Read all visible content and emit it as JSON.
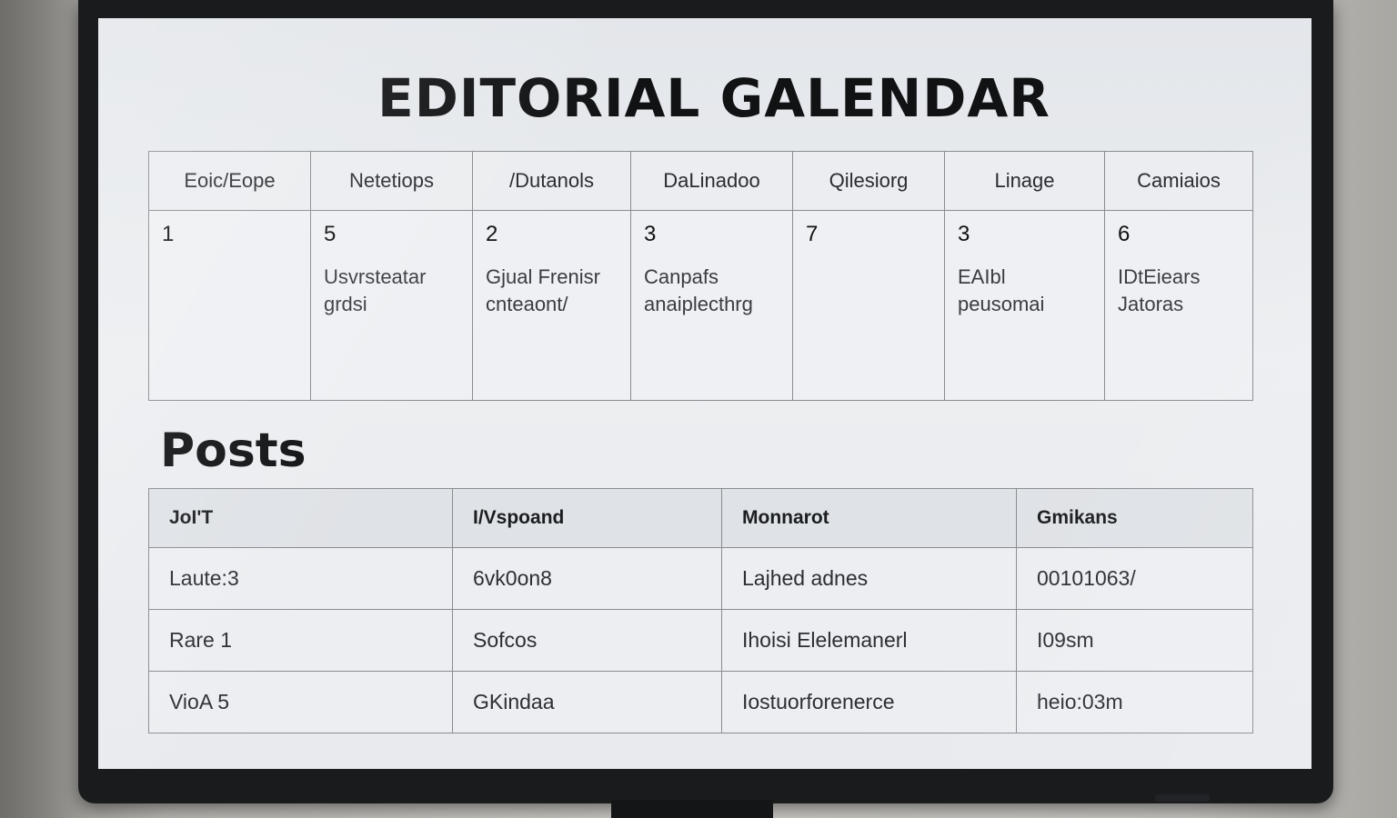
{
  "page_title": "EDITORIAL GALENDAR",
  "calendar": {
    "headers": [
      "Eoic/Eope",
      "Netetiops",
      "/Dutanols",
      "DaLinadoo",
      "Qilesiorg",
      "Linage",
      "Camiaios"
    ],
    "cells": [
      {
        "num": "1",
        "line1": "",
        "line2": ""
      },
      {
        "num": "5",
        "line1": "Usvrsteatar",
        "line2": "grdsi"
      },
      {
        "num": "2",
        "line1": "Gjual Frenisr",
        "line2": "cnteaont/"
      },
      {
        "num": "3",
        "line1": "Canpafs",
        "line2": "anaiplecthrg"
      },
      {
        "num": "7",
        "line1": "",
        "line2": ""
      },
      {
        "num": "3",
        "line1": "EAIbl",
        "line2": "peusomai"
      },
      {
        "num": "6",
        "line1": "IDtEiears",
        "line2": "Jatoras"
      }
    ]
  },
  "posts": {
    "title": "Posts",
    "headers": [
      "JoI'T",
      "I/Vspoand",
      "Monnarot",
      "Gmikans"
    ],
    "rows": [
      [
        "Laute:3",
        "6vk0on8",
        "Lajhed adnes",
        "00101063/"
      ],
      [
        "Rare 1",
        "Sofcos",
        "Ihoisi Elelemanerl",
        "I09sm"
      ],
      [
        "VioA 5",
        "GKindaa",
        "Iostuorforenerce",
        "heio:03m"
      ]
    ]
  }
}
